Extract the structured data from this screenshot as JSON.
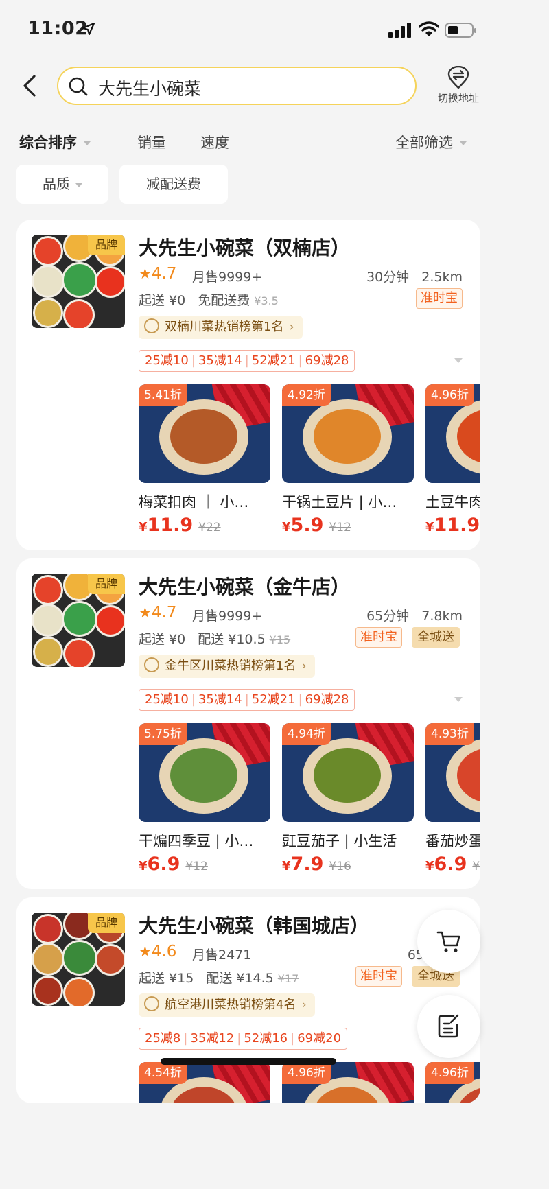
{
  "status_bar": {
    "time": "11:02"
  },
  "header": {
    "search_value": "大先生小碗菜",
    "address_switch_label": "切换地址"
  },
  "sort_bar": {
    "items": [
      "综合排序",
      "销量",
      "速度"
    ],
    "filter_label": "全部筛选"
  },
  "chips": [
    "品质",
    "减配送费"
  ],
  "colors": {
    "accent": "#f5d35a",
    "price": "#e8331e",
    "discount_badge": "#f46b3a",
    "rating": "#f28a1c"
  },
  "stores": [
    {
      "brand_badge": "品牌",
      "name": "大先生小碗菜（双楠店）",
      "rating": "4.7",
      "monthly_sales": "月售9999+",
      "delivery_time": "30分钟",
      "distance": "2.5km",
      "min_order": "起送 ¥0",
      "delivery_fee": "免配送费",
      "delivery_fee_original": "¥3.5",
      "tags": [
        "准时宝"
      ],
      "ranking": "双楠川菜热销榜第1名",
      "discounts": [
        "25减10",
        "35减14",
        "52减21",
        "69减28"
      ],
      "dishes": [
        {
          "discount": "5.41折",
          "name": "梅菜扣肉 ｜ 小…",
          "price_symbol": "¥",
          "price": "11.9",
          "original": "¥22"
        },
        {
          "discount": "4.92折",
          "name": "干锅土豆片 | 小…",
          "price_symbol": "¥",
          "price": "5.9",
          "original": "¥12"
        },
        {
          "discount": "4.96折",
          "name": "土豆牛肉",
          "price_symbol": "¥",
          "price": "11.9",
          "original": ""
        }
      ]
    },
    {
      "brand_badge": "品牌",
      "name": "大先生小碗菜（金牛店）",
      "rating": "4.7",
      "monthly_sales": "月售9999+",
      "delivery_time": "65分钟",
      "distance": "7.8km",
      "min_order": "起送 ¥0",
      "delivery_fee": "配送 ¥10.5",
      "delivery_fee_original": "¥15",
      "tags": [
        "准时宝",
        "全城送"
      ],
      "ranking": "金牛区川菜热销榜第1名",
      "discounts": [
        "25减10",
        "35减14",
        "52减21",
        "69减28"
      ],
      "dishes": [
        {
          "discount": "5.75折",
          "name": "干煸四季豆 | 小…",
          "price_symbol": "¥",
          "price": "6.9",
          "original": "¥12"
        },
        {
          "discount": "4.94折",
          "name": "豇豆茄子 | 小生活",
          "price_symbol": "¥",
          "price": "7.9",
          "original": "¥16"
        },
        {
          "discount": "4.93折",
          "name": "番茄炒蛋",
          "price_symbol": "¥",
          "price": "6.9",
          "original": "¥"
        }
      ]
    },
    {
      "brand_badge": "品牌",
      "name": "大先生小碗菜（韩国城店）",
      "rating": "4.6",
      "monthly_sales": "月售2471",
      "delivery_time": "65分钟",
      "distance": "",
      "min_order": "起送 ¥15",
      "delivery_fee": "配送 ¥14.5",
      "delivery_fee_original": "¥17",
      "tags": [
        "准时宝",
        "全城送"
      ],
      "ranking": "航空港川菜热销榜第4名",
      "discounts": [
        "25减8",
        "35减12",
        "52减16",
        "69减20"
      ],
      "dishes": [
        {
          "discount": "4.54折",
          "name": "",
          "price_symbol": "",
          "price": "",
          "original": ""
        },
        {
          "discount": "4.96折",
          "name": "",
          "price_symbol": "",
          "price": "",
          "original": ""
        },
        {
          "discount": "4.96折",
          "name": "",
          "price_symbol": "",
          "price": "",
          "original": ""
        }
      ]
    }
  ]
}
